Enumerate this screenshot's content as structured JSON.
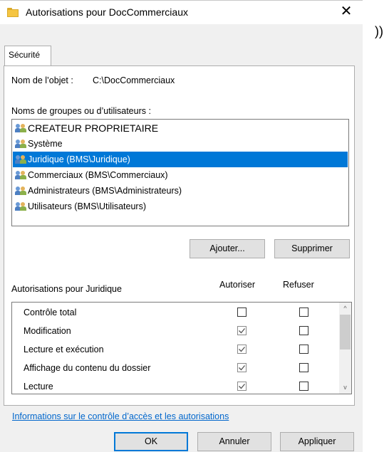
{
  "window": {
    "title": "Autorisations pour DocCommerciaux",
    "close_label": "✕",
    "stray_text": "))"
  },
  "tabs": [
    {
      "label": "Sécurité"
    }
  ],
  "object": {
    "label": "Nom de l’objet :",
    "value": "C:\\DocCommerciaux"
  },
  "users": {
    "header": "Noms de groupes ou d’utilisateurs :",
    "items": [
      {
        "label": "CREATEUR PROPRIETAIRE"
      },
      {
        "label": "Système"
      },
      {
        "label": "Juridique (BMS\\Juridique)",
        "selected": true
      },
      {
        "label": "Commerciaux (BMS\\Commerciaux)"
      },
      {
        "label": "Administrateurs (BMS\\Administrateurs)"
      },
      {
        "label": "Utilisateurs (BMS\\Utilisateurs)"
      }
    ]
  },
  "buttons": {
    "add": "Ajouter...",
    "remove": "Supprimer",
    "ok": "OK",
    "cancel": "Annuler",
    "apply": "Appliquer"
  },
  "permissions": {
    "header": "Autorisations pour Juridique",
    "allow_header": "Autoriser",
    "deny_header": "Refuser",
    "rows": [
      {
        "label": "Contrôle total",
        "allow": false,
        "deny": false
      },
      {
        "label": "Modification",
        "allow": true,
        "deny": false
      },
      {
        "label": "Lecture et exécution",
        "allow": true,
        "deny": false
      },
      {
        "label": "Affichage du contenu du dossier",
        "allow": true,
        "deny": false
      },
      {
        "label": "Lecture",
        "allow": true,
        "deny": false
      }
    ],
    "scroll_up": "^",
    "scroll_down": "v"
  },
  "link": "Informations sur le contrôle d’accès et les autorisations",
  "colors": {
    "selection": "#0078d7",
    "link": "#0066cc"
  }
}
